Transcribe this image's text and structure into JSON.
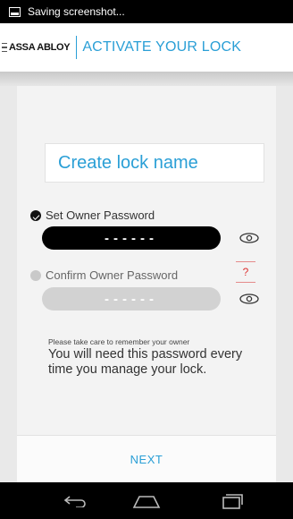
{
  "status_bar": {
    "text": "Saving screenshot..."
  },
  "app_bar": {
    "brand": "ASSA ABLOY",
    "title": "ACTIVATE YOUR LOCK",
    "accent": "#2a9fd6"
  },
  "form": {
    "lock_name_placeholder": "Create lock name",
    "set_password_label": "Set Owner Password",
    "set_password_value": "------",
    "confirm_password_label": "Confirm Owner Password",
    "confirm_password_value": "------",
    "help_symbol": "?",
    "hint_small": "Please take care to remember your owner",
    "hint_large": "You will need this password every time you manage your lock."
  },
  "footer": {
    "next_label": "NEXT"
  },
  "nav": {
    "back_icon": "back-icon",
    "home_icon": "home-icon",
    "recents_icon": "recents-icon"
  }
}
